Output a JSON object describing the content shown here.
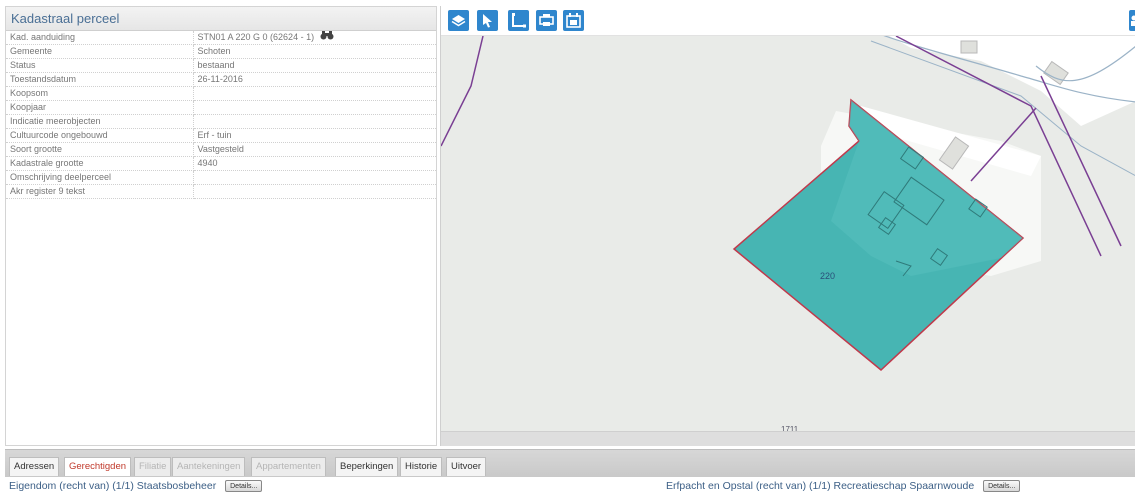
{
  "panel": {
    "title": "Kadastraal perceel",
    "rows": [
      {
        "label": "Kad. aanduiding",
        "value": "STN01 A 220 G 0 (62624 - 1)"
      },
      {
        "label": "Gemeente",
        "value": "Schoten"
      },
      {
        "label": "Status",
        "value": "bestaand"
      },
      {
        "label": "Toestandsdatum",
        "value": "26-11-2016"
      },
      {
        "label": "Koopsom",
        "value": ""
      },
      {
        "label": "Koopjaar",
        "value": ""
      },
      {
        "label": "Indicatie meerobjecten",
        "value": ""
      },
      {
        "label": "Cultuurcode ongebouwd",
        "value": "Erf - tuin"
      },
      {
        "label": "Soort grootte",
        "value": "Vastgesteld"
      },
      {
        "label": "Kadastrale grootte",
        "value": "4940"
      },
      {
        "label": "Omschrijving deelperceel",
        "value": ""
      },
      {
        "label": "Akr register 9 tekst",
        "value": ""
      }
    ],
    "aanduiding_icon": "binoculars-icon"
  },
  "map": {
    "parcel_label": "220",
    "scale_label": "1711",
    "parcel_fill": "#47b5b3",
    "parcel_stroke": "#c0394b",
    "toolbar_color": "#2f86cd",
    "tools": [
      {
        "name": "layers-tool",
        "icon": "layers-icon"
      },
      {
        "name": "select-tool",
        "icon": "cursor-arrow-icon"
      },
      {
        "name": "measure-tool",
        "icon": "measure-corner-icon"
      },
      {
        "name": "print-tool",
        "icon": "printer-icon"
      },
      {
        "name": "calendar-tool",
        "icon": "calendar-icon"
      }
    ]
  },
  "tabs": [
    {
      "label": "Adressen",
      "state": "normal"
    },
    {
      "label": "Gerechtigden",
      "state": "active"
    },
    {
      "label": "Filiatie",
      "state": "disabled"
    },
    {
      "label": "Aantekeningen",
      "state": "disabled"
    },
    {
      "label": "Appartementen",
      "state": "disabled"
    },
    {
      "label": "Beperkingen",
      "state": "normal"
    },
    {
      "label": "Historie",
      "state": "normal"
    },
    {
      "label": "Uitvoer",
      "state": "normal"
    }
  ],
  "rights": [
    {
      "text": "Eigendom (recht van) (1/1) Staatsbosbeheer",
      "button": "Details..."
    },
    {
      "text": "Erfpacht en Opstal (recht van) (1/1) Recreatieschap Spaarnwoude",
      "button": "Details..."
    }
  ]
}
